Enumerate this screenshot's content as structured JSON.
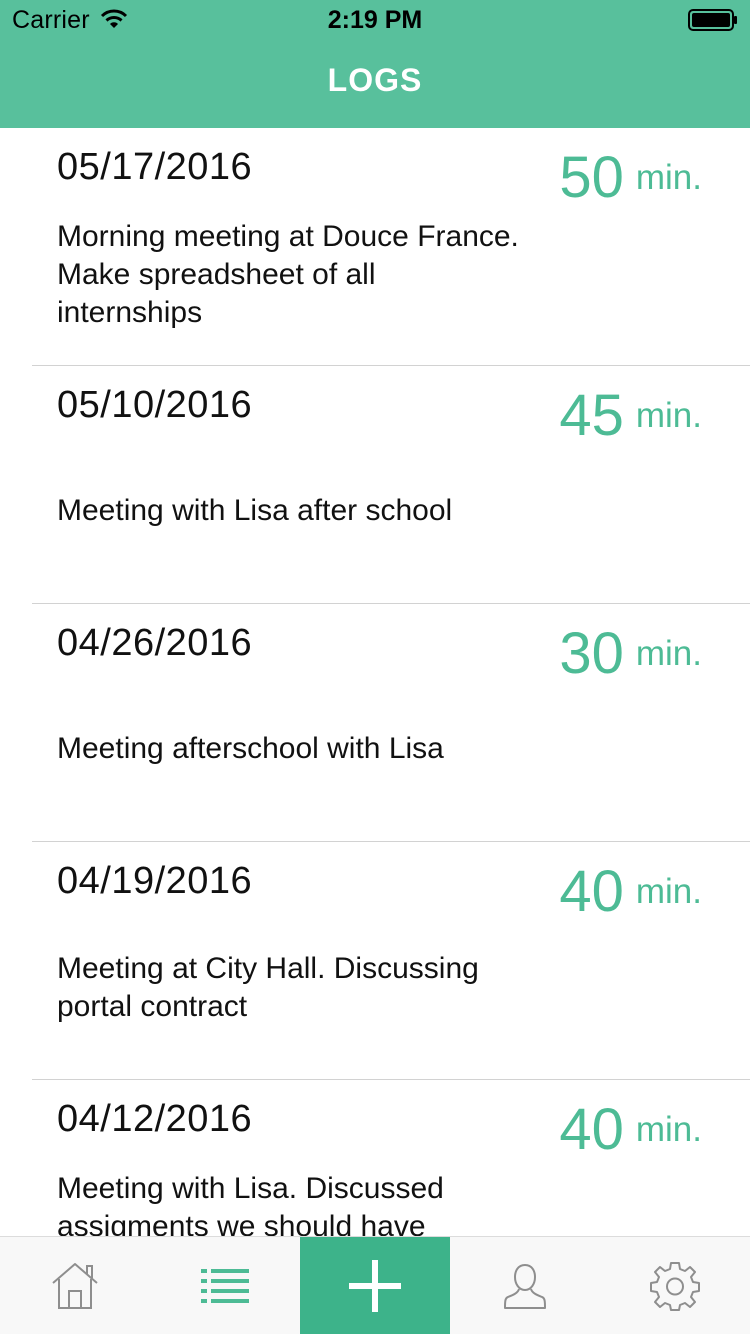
{
  "status_bar": {
    "carrier": "Carrier",
    "time": "2:19 PM"
  },
  "nav": {
    "title": "LOGS"
  },
  "colors": {
    "header": "#58c09c",
    "accent": "#4dbb95",
    "add_tab": "#3db38a"
  },
  "logs": [
    {
      "date": "05/17/2016",
      "minutes": "50",
      "unit": "min.",
      "note": "Morning meeting at Douce France. Make spreadsheet of all internships"
    },
    {
      "date": "05/10/2016",
      "minutes": "45",
      "unit": "min.",
      "note": "Meeting with Lisa after school"
    },
    {
      "date": "04/26/2016",
      "minutes": "30",
      "unit": "min.",
      "note": "Meeting afterschool with Lisa"
    },
    {
      "date": "04/19/2016",
      "minutes": "40",
      "unit": "min.",
      "note": "Meeting at City Hall. Discussing portal contract"
    },
    {
      "date": "04/12/2016",
      "minutes": "40",
      "unit": "min.",
      "note": "Meeting with Lisa. Discussed assigments we should have"
    }
  ],
  "tabs": [
    {
      "icon": "home-icon",
      "active": false
    },
    {
      "icon": "list-icon",
      "active": true
    },
    {
      "icon": "plus-icon",
      "active": false
    },
    {
      "icon": "person-icon",
      "active": false
    },
    {
      "icon": "gear-icon",
      "active": false
    }
  ]
}
